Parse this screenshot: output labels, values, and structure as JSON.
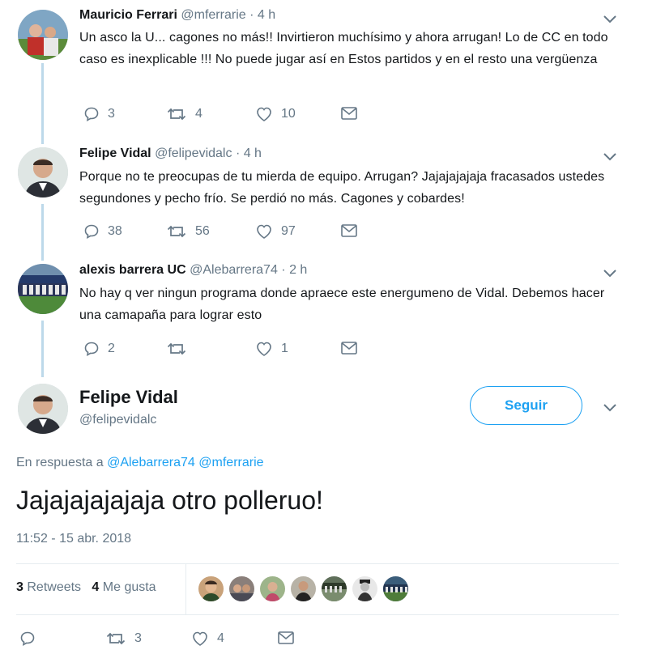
{
  "thread": [
    {
      "name": "Mauricio Ferrari",
      "handle": "@mferrarie",
      "time": "· 4 h",
      "text": "Un asco la U... cagones no más!! Invirtieron muchísimo y ahora arrugan! Lo de CC en todo caso es inexplicable !!! No puede jugar así en Estos partidos y en el resto una vergüenza",
      "replies": "3",
      "retweets": "4",
      "likes": "10"
    },
    {
      "name": "Felipe Vidal",
      "handle": "@felipevidalc",
      "time": "· 4 h",
      "text": "Porque no te preocupas de tu mierda de equipo. Arrugan? Jajajajajaja fracasados ustedes segundones y pecho frío. Se perdió no más. Cagones y cobardes!",
      "replies": "38",
      "retweets": "56",
      "likes": "97"
    },
    {
      "name": "alexis barrera UC",
      "handle": "@Alebarrera74",
      "time": "· 2 h",
      "text": "No hay q ver ningun programa donde apraece este energumeno de Vidal. Debemos hacer una camapaña para lograr esto",
      "replies": "2",
      "retweets": "",
      "likes": "1"
    }
  ],
  "main": {
    "name": "Felipe Vidal",
    "handle": "@felipevidalc",
    "follow_label": "Seguir",
    "reply_prefix": "En respuesta a",
    "reply_mentions": [
      "@Alebarrera74",
      "@mferrarie"
    ],
    "text": "Jajajajajajaja otro polleruo!",
    "timestamp": "11:52 - 15 abr. 2018",
    "retweets_count": "3",
    "retweets_label": "Retweets",
    "likes_count": "4",
    "likes_label": "Me gusta",
    "reply_count": "",
    "retweet_count_bottom": "3",
    "like_count_bottom": "4"
  },
  "icons": {
    "reply": "reply-icon",
    "retweet": "retweet-icon",
    "like": "heart-icon",
    "dm": "envelope-icon",
    "more": "chevron-down-icon"
  },
  "colors": {
    "accent": "#1da1f2",
    "muted": "#657786",
    "thread_line": "#bdd9ea"
  }
}
